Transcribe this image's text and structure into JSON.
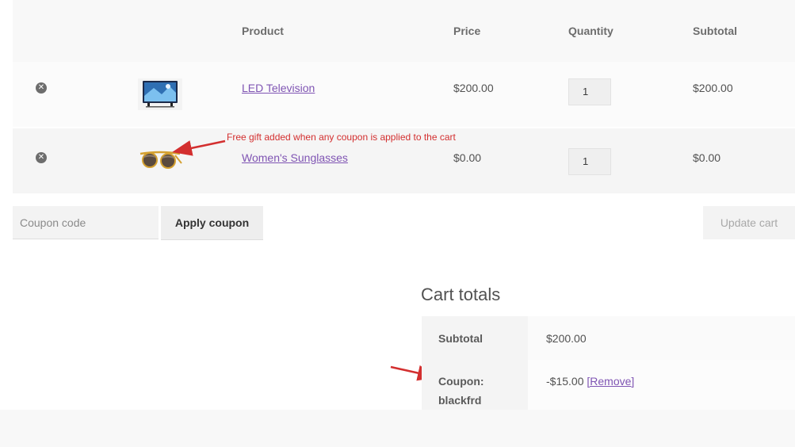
{
  "table": {
    "headers": {
      "product": "Product",
      "price": "Price",
      "quantity": "Quantity",
      "subtotal": "Subtotal"
    },
    "items": [
      {
        "name": "LED Television",
        "price": "$200.00",
        "quantity": "1",
        "subtotal": "$200.00",
        "remove_icon": "remove-circle-x-icon"
      },
      {
        "name": "Women's Sunglasses",
        "price": "$0.00",
        "quantity": "1",
        "subtotal": "$0.00",
        "remove_icon": "remove-circle-x-icon"
      }
    ]
  },
  "annotation": {
    "text": "Free gift added when any coupon is applied to the cart",
    "color": "#d32f2f"
  },
  "coupon": {
    "placeholder": "Coupon code",
    "apply_label": "Apply coupon",
    "update_label": "Update cart"
  },
  "totals": {
    "title": "Cart totals",
    "subtotal_label": "Subtotal",
    "subtotal_value": "$200.00",
    "coupon_label_1": "Coupon:",
    "coupon_label_2": "blackfrd",
    "coupon_value": "-$15.00",
    "coupon_remove": "[Remove]"
  },
  "colors": {
    "link": "#7f54b3",
    "annotation_red": "#d32f2f"
  }
}
